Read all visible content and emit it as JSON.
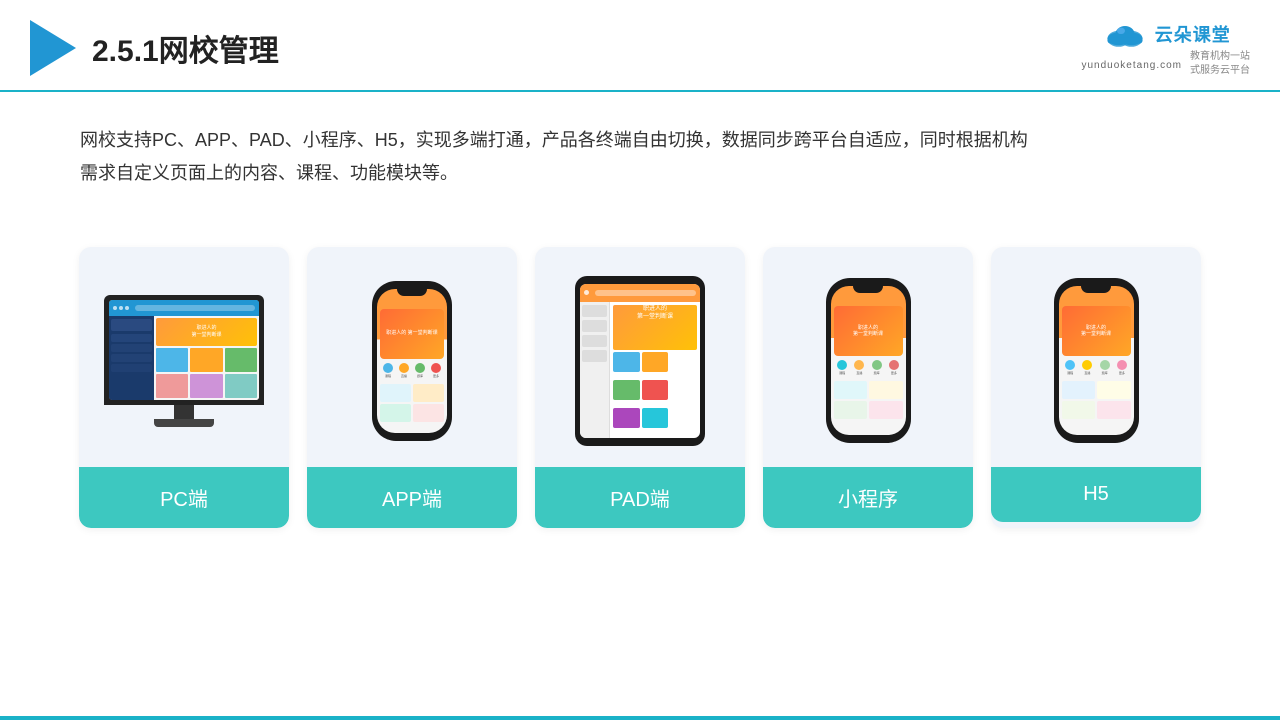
{
  "header": {
    "title": "2.5.1网校管理",
    "logo_cn": "云朵课堂",
    "logo_en": "yunduoketang.com",
    "logo_tagline_line1": "教育机构一站",
    "logo_tagline_line2": "式服务云平台"
  },
  "description": {
    "text": "网校支持PC、APP、PAD、小程序、H5，实现多端打通，产品各终端自由切换，数据同步跨平台自适应，同时根据机构需求自定义页面上的内容、课程、功能模块等。"
  },
  "cards": [
    {
      "id": "pc",
      "label": "PC端"
    },
    {
      "id": "app",
      "label": "APP端"
    },
    {
      "id": "pad",
      "label": "PAD端"
    },
    {
      "id": "miniapp",
      "label": "小程序"
    },
    {
      "id": "h5",
      "label": "H5"
    }
  ],
  "phone_banner_text": "职进人的\n第一堂判断课",
  "colors": {
    "accent": "#3dc8c0",
    "header_line": "#1ab2c8",
    "logo_blue": "#2196d3"
  }
}
